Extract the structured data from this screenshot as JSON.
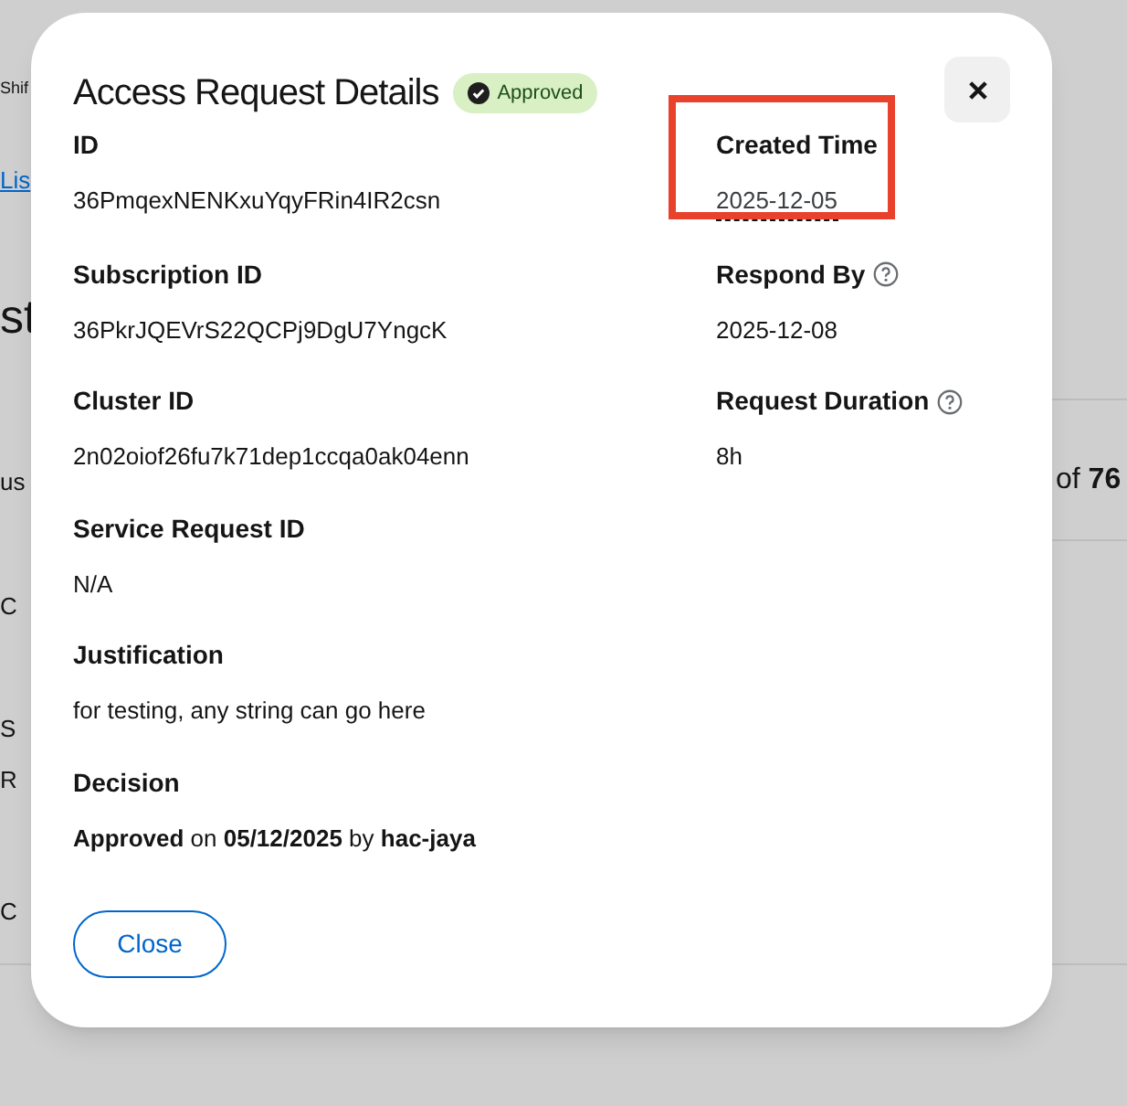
{
  "background": {
    "texts_left": [
      {
        "text": "Shif",
        "kind": "plain"
      },
      {
        "text": "Lis",
        "kind": "link"
      },
      {
        "text": "st",
        "kind": "heading"
      },
      {
        "text": "us",
        "kind": "plain"
      },
      {
        "text": "C",
        "kind": "plain"
      },
      {
        "text": "S",
        "kind": "plain"
      },
      {
        "text": "R",
        "kind": "plain"
      },
      {
        "text": "C",
        "kind": "plain"
      }
    ],
    "count_prefix": "of",
    "count": "76"
  },
  "dialog": {
    "title": "Access Request Details",
    "status": {
      "label": "Approved",
      "kind": "approved"
    },
    "rows": [
      {
        "left": {
          "label": "ID",
          "value": "36PmqexNENKxuYqyFRin4IR2csn"
        },
        "right": {
          "label": "Created Time",
          "value": "2025-12-05",
          "help": false,
          "dotted": true,
          "highlighted": true
        }
      },
      {
        "left": {
          "label": "Subscription ID",
          "value": "36PkrJQEVrS22QCPj9DgU7YngcK"
        },
        "right": {
          "label": "Respond By",
          "value": "2025-12-08",
          "help": true,
          "dotted": false,
          "highlighted": false
        }
      },
      {
        "left": {
          "label": "Cluster ID",
          "value": "2n02oiof26fu7k71dep1ccqa0ak04enn"
        },
        "right": {
          "label": "Request Duration",
          "value": "8h",
          "help": true,
          "dotted": false,
          "highlighted": false
        }
      },
      {
        "left": {
          "label": "Service Request ID",
          "value": "N/A"
        }
      },
      {
        "left": {
          "label": "Justification",
          "value": "for testing, any string can go here"
        }
      },
      {
        "left": {
          "label": "Decision",
          "value": "**Approved** on **05/12/2025** by **hac-jaya**"
        }
      }
    ],
    "close_button": "Close"
  }
}
